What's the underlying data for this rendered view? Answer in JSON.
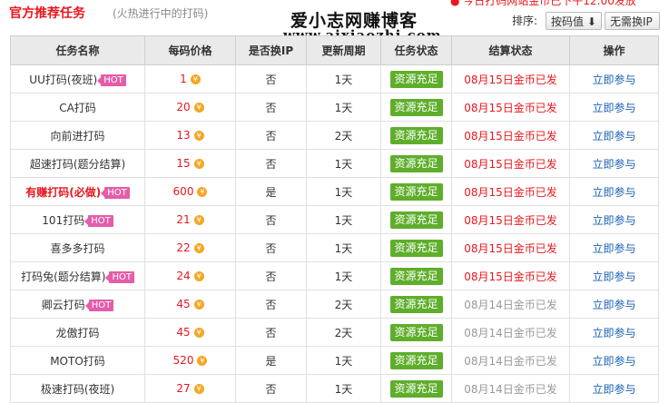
{
  "header": {
    "title": "官方推荐任务",
    "subtitle": "(火热进行中的打码)",
    "watermark_cn": "爱小志网赚博客",
    "watermark_url": "www.aixiaozhi.com",
    "notice": "● 今日打码网站金币已下午12:00发放"
  },
  "sort": {
    "label": "排序:",
    "option_selected": "按码值 ⬇",
    "option_other": "无需换IP"
  },
  "table": {
    "headers": [
      "任务名称",
      "每码价格",
      "是否换IP",
      "更新周期",
      "任务状态",
      "结算状态",
      "操作"
    ],
    "rows": [
      {
        "name": "UU打码(夜班)",
        "hot": "HOT",
        "price": "1",
        "ip": "否",
        "cycle": "1天",
        "status": "资源充足",
        "settle": "08月15日金币已发",
        "action": "立即参与"
      },
      {
        "name": "CA打码",
        "hot": "",
        "price": "20",
        "ip": "否",
        "cycle": "1天",
        "status": "资源充足",
        "settle": "08月15日金币已发",
        "action": "立即参与"
      },
      {
        "name": "向前进打码",
        "hot": "",
        "price": "13",
        "ip": "否",
        "cycle": "2天",
        "status": "资源充足",
        "settle": "08月15日金币已发",
        "action": "立即参与"
      },
      {
        "name": "超速打码(题分结算)",
        "hot": "",
        "price": "15",
        "ip": "否",
        "cycle": "1天",
        "status": "资源充足",
        "settle": "08月15日金币已发",
        "action": "立即参与"
      },
      {
        "name": "有赚打码(必做)",
        "hot": "HOT",
        "price": "600",
        "ip": "是",
        "cycle": "1天",
        "status": "资源充足",
        "settle": "08月15日金币已发",
        "action": "立即参与"
      },
      {
        "name": "101打码",
        "hot": "HOT",
        "price": "21",
        "ip": "否",
        "cycle": "1天",
        "status": "资源充足",
        "settle": "08月15日金币已发",
        "action": "立即参与"
      },
      {
        "name": "喜多多打码",
        "hot": "",
        "price": "22",
        "ip": "否",
        "cycle": "1天",
        "status": "资源充足",
        "settle": "08月15日金币已发",
        "action": "立即参与"
      },
      {
        "name": "打码兔(题分结算)",
        "hot": "HOT",
        "price": "24",
        "ip": "否",
        "cycle": "1天",
        "status": "资源充足",
        "settle": "08月15日金币已发",
        "action": "立即参与"
      },
      {
        "name": "卿云打码",
        "hot": "HOT",
        "price": "45",
        "ip": "否",
        "cycle": "2天",
        "status": "资源充足",
        "settle": "08月14日金币已发",
        "action": "立即参与"
      },
      {
        "name": "龙傲打码",
        "hot": "",
        "price": "45",
        "ip": "否",
        "cycle": "2天",
        "status": "资源充足",
        "settle": "08月14日金币已发",
        "action": "立即参与"
      },
      {
        "name": "MOTO打码",
        "hot": "",
        "price": "520",
        "ip": "是",
        "cycle": "1天",
        "status": "资源充足",
        "settle": "08月14日金币已发",
        "action": "立即参与"
      },
      {
        "name": "极速打码(夜班)",
        "hot": "",
        "price": "27",
        "ip": "否",
        "cycle": "1天",
        "status": "资源充足",
        "settle": "08月14日金币已发",
        "action": "立即参与"
      }
    ],
    "coin_glyph": "¥"
  },
  "colors": {
    "accent_red": "#e8171d",
    "badge_green": "#5fae2b",
    "hot_pink": "#e35daa",
    "link_blue": "#1a5fb4"
  }
}
